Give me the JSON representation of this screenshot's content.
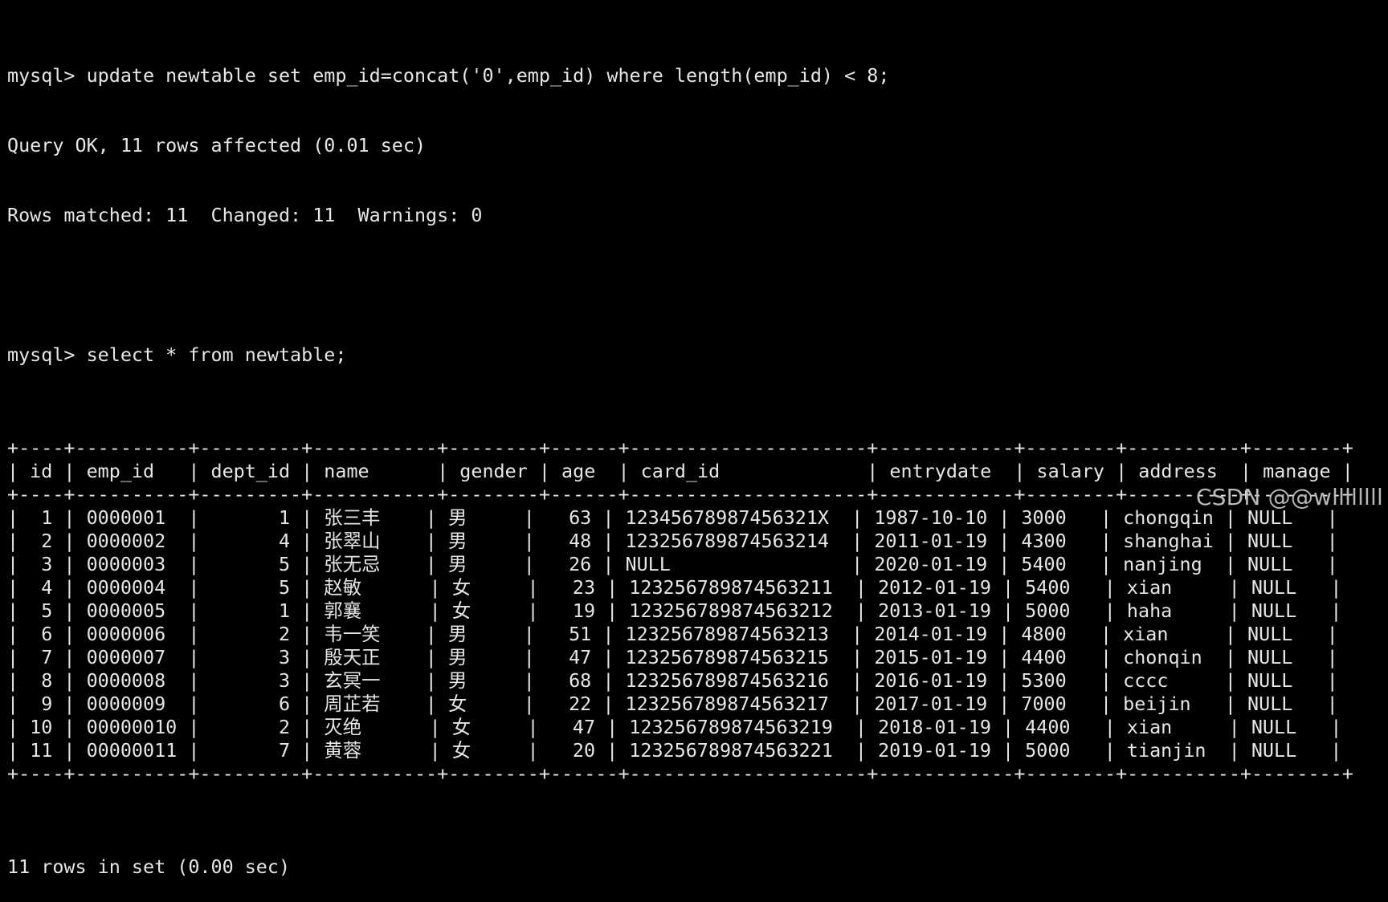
{
  "terminal": {
    "header_lines": [
      "mysql> update newtable set emp_id=concat('0',emp_id) where length(emp_id) < 8;",
      "Query OK, 11 rows affected (0.01 sec)",
      "Rows matched: 11  Changed: 11  Warnings: 0",
      "",
      "mysql> select * from newtable;"
    ],
    "table": {
      "columns": [
        "id",
        "emp_id",
        "dept_id",
        "name",
        "gender",
        "age",
        "card_id",
        "entrydate",
        "salary",
        "address",
        "manage"
      ],
      "rows": [
        [
          "1",
          "0000001",
          "1",
          "张三丰",
          "男",
          "63",
          "12345678987456321X",
          "1987-10-10",
          "3000",
          "chongqin",
          "NULL"
        ],
        [
          "2",
          "0000002",
          "4",
          "张翠山",
          "男",
          "48",
          "123256789874563214",
          "2011-01-19",
          "4300",
          "shanghai",
          "NULL"
        ],
        [
          "3",
          "0000003",
          "5",
          "张无忌",
          "男",
          "26",
          "NULL",
          "2020-01-19",
          "5400",
          "nanjing",
          "NULL"
        ],
        [
          "4",
          "0000004",
          "5",
          "赵敏",
          "女",
          "23",
          "123256789874563211",
          "2012-01-19",
          "5400",
          "xian",
          "NULL"
        ],
        [
          "5",
          "0000005",
          "1",
          "郭襄",
          "女",
          "19",
          "123256789874563212",
          "2013-01-19",
          "5000",
          "haha",
          "NULL"
        ],
        [
          "6",
          "0000006",
          "2",
          "韦一笑",
          "男",
          "51",
          "123256789874563213",
          "2014-01-19",
          "4800",
          "xian",
          "NULL"
        ],
        [
          "7",
          "0000007",
          "3",
          "殷天正",
          "男",
          "47",
          "123256789874563215",
          "2015-01-19",
          "4400",
          "chonqin",
          "NULL"
        ],
        [
          "8",
          "0000008",
          "3",
          "玄冥一",
          "男",
          "68",
          "123256789874563216",
          "2016-01-19",
          "5300",
          "cccc",
          "NULL"
        ],
        [
          "9",
          "0000009",
          "6",
          "周芷若",
          "女",
          "22",
          "123256789874563217",
          "2017-01-19",
          "7000",
          "beijin",
          "NULL"
        ],
        [
          "10",
          "00000010",
          "2",
          "灭绝",
          "女",
          "47",
          "123256789874563219",
          "2018-01-19",
          "4400",
          "xian",
          "NULL"
        ],
        [
          "11",
          "00000011",
          "7",
          "黄蓉",
          "女",
          "20",
          "123256789874563221",
          "2019-01-19",
          "5000",
          "tianjin",
          "NULL"
        ]
      ]
    },
    "footer_line": "11 rows in set (0.00 sec)"
  },
  "watermark": "CSDN @@wllllllll",
  "colors": {
    "background": "#000000",
    "text": "#e6e6e6",
    "watermark": "#b8b8b8"
  }
}
